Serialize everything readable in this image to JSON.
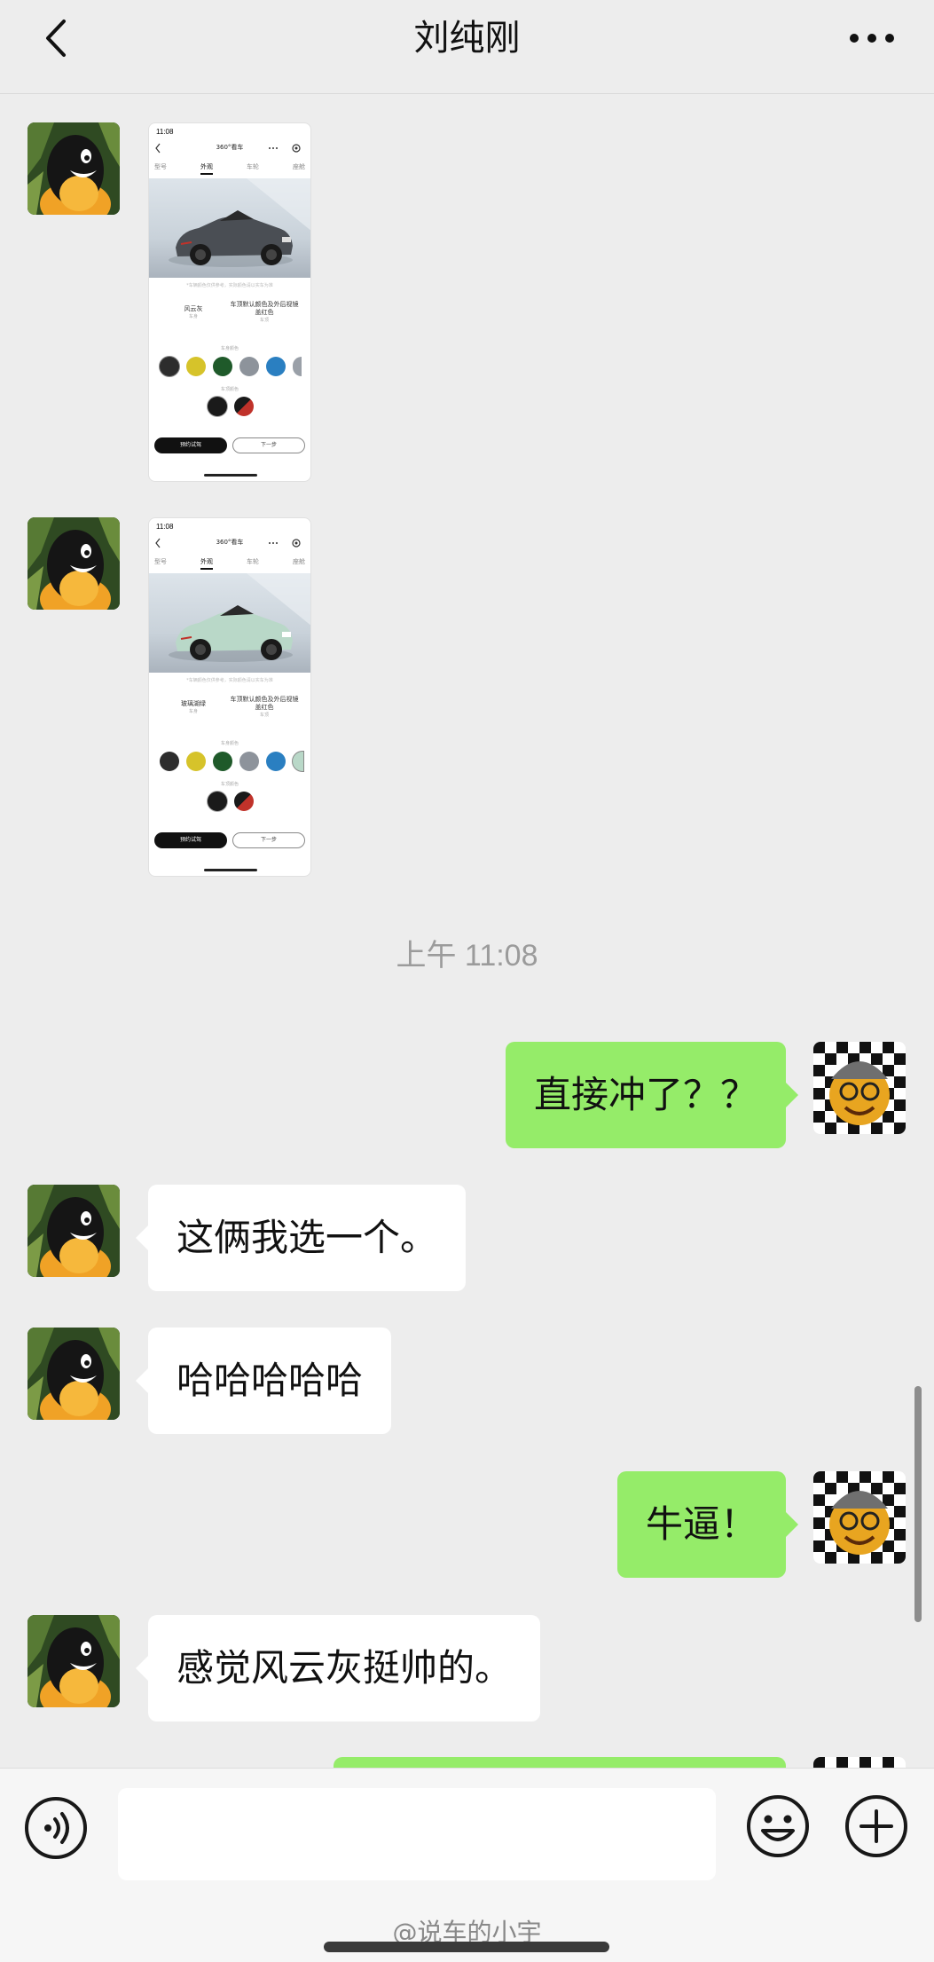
{
  "header": {
    "title": "刘纯刚",
    "back_icon": "chevron-left-icon",
    "more_icon": "more-horizontal-icon"
  },
  "thumbnails": [
    {
      "time": "11:08",
      "nav_title": "360°看车",
      "tabs": [
        "型号",
        "外观",
        "车轮",
        "座舱"
      ],
      "desc": "*车辆颜色仅供参考，实际颜色请以实车为准",
      "color_name": "风云灰",
      "color_sub": "车身",
      "roof_name": "车顶默认颜色及外后视镜盖红色",
      "roof_sub": "车顶",
      "body_color_label": "车身颜色",
      "roof_color_label": "车顶颜色",
      "btn_primary": "预约试驾",
      "btn_secondary": "下一步",
      "car_color": "#4a4e54"
    },
    {
      "time": "11:08",
      "nav_title": "360°看车",
      "tabs": [
        "型号",
        "外观",
        "车轮",
        "座舱"
      ],
      "desc": "*车辆颜色仅供参考，实际颜色请以实车为准",
      "color_name": "玻璃湖绿",
      "color_sub": "车身",
      "roof_name": "车顶默认颜色及外后视镜盖红色",
      "roof_sub": "车顶",
      "body_color_label": "车身颜色",
      "roof_color_label": "车顶颜色",
      "btn_primary": "预约试驾",
      "btn_secondary": "下一步",
      "car_color": "#b9d8c8"
    }
  ],
  "timestamp": "上午 11:08",
  "messages": [
    {
      "side": "right",
      "text": "直接冲了？？"
    },
    {
      "side": "left",
      "text": "这俩我选一个。"
    },
    {
      "side": "left",
      "text": "哈哈哈哈哈"
    },
    {
      "side": "right",
      "text": "牛逼！"
    },
    {
      "side": "left",
      "text": "感觉风云灰挺帅的。"
    },
    {
      "side": "right",
      "text": ""
    }
  ],
  "input": {
    "placeholder": "",
    "voice_icon": "voice-icon",
    "emoji_icon": "emoji-icon",
    "plus_icon": "plus-circle-icon"
  },
  "watermark": "@说车的小宇",
  "colors": {
    "bubble_self": "#95ec69",
    "bubble_other": "#ffffff",
    "background": "#ededed"
  }
}
